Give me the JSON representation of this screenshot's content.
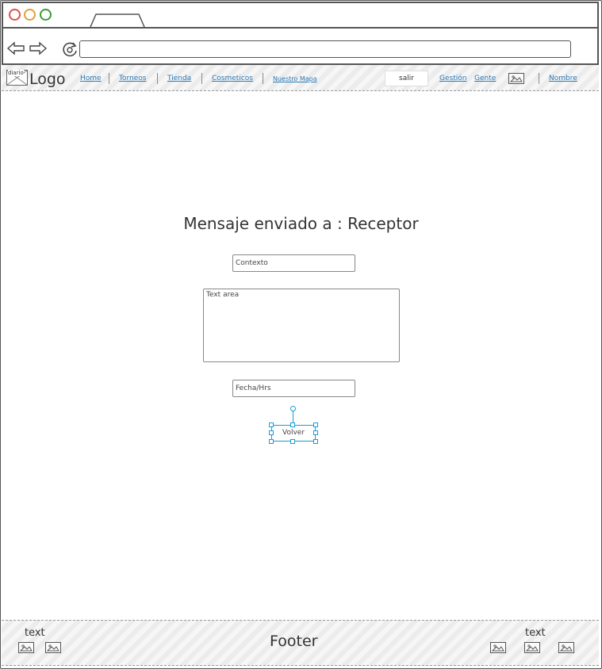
{
  "nav": {
    "logo_image_label": "diario",
    "logo_text": "Logo",
    "links": [
      "Home",
      "Torneos",
      "Tienda",
      "Cosmeticos",
      "Nuestro Mapa"
    ],
    "logout_button": "salir",
    "right_links": [
      "Gestión",
      "Gente"
    ],
    "user_name": "Nombre"
  },
  "main": {
    "title": "Mensaje enviado a : Receptor",
    "context_field": "Contexto",
    "text_area": "Text area",
    "date_field": "Fecha/Hrs",
    "back_button": "Volver"
  },
  "footer": {
    "left_text": "text",
    "center_text": "Footer",
    "right_text": "text"
  },
  "colors": {
    "link": "#2a7ab5",
    "selection": "#1a9bd7",
    "window_red": "#d9534f",
    "window_yellow": "#e0a03a",
    "window_green": "#3a9a3a"
  }
}
